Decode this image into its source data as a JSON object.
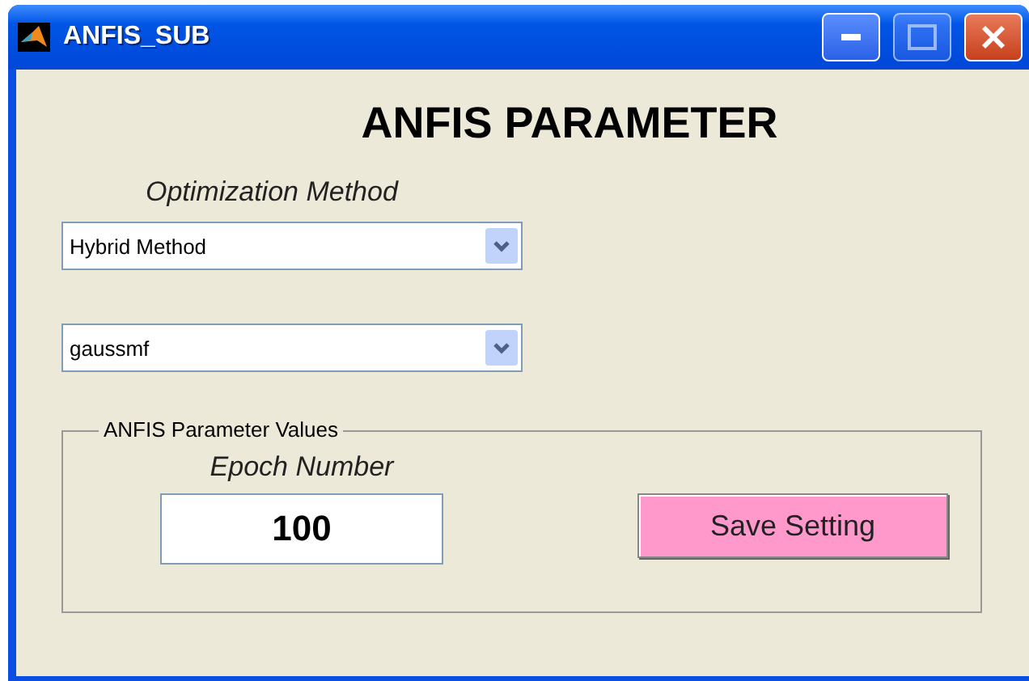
{
  "window": {
    "title": "ANFIS_SUB"
  },
  "heading": "ANFIS PARAMETER",
  "optimization": {
    "label": "Optimization Method",
    "value": "Hybrid Method"
  },
  "membership": {
    "value": "gaussmf"
  },
  "group": {
    "legend": "ANFIS Parameter Values",
    "epoch_label": "Epoch Number",
    "epoch_value": "100",
    "button": "Save Setting"
  }
}
